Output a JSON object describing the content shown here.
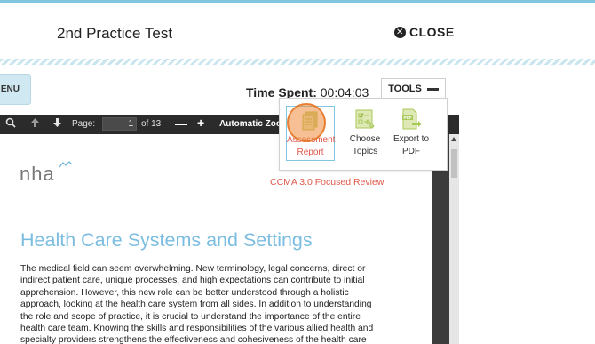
{
  "header": {
    "title": "2nd Practice Test",
    "close_label": "CLOSE"
  },
  "menu": {
    "label": "ENU"
  },
  "timer": {
    "label": "Time Spent:",
    "value": "00:04:03"
  },
  "tools": {
    "tab_label": "TOOLS",
    "items": [
      {
        "label_line1": "Assessment",
        "label_line2": "Report",
        "icon": "assessment-report-icon"
      },
      {
        "label_line1": "Choose",
        "label_line2": "Topics",
        "icon": "choose-topics-icon"
      },
      {
        "label_line1": "Export to",
        "label_line2": "PDF",
        "icon": "export-pdf-icon"
      }
    ]
  },
  "pdf_toolbar": {
    "page_label": "Page:",
    "page_value": "1",
    "page_total": "of 13",
    "zoom_label": "Automatic Zoom"
  },
  "document": {
    "logo_text": "nha",
    "review_tag": "CCMA 3.0 Focused Review",
    "heading": "Health Care Systems and Settings",
    "body": "The medical field can seem overwhelming. New terminology, legal concerns, direct or indirect patient care, unique processes, and high expectations can contribute to initial apprehension. However, this new role can be better understood through a holistic approach, looking at the health care system from all sides. In addition to understanding the role and scope of practice, it is crucial to understand the importance of the entire health care team. Knowing the skills and responsibilities of the various allied health and specialty providers strengthens the effectiveness and cohesiveness of the health care"
  },
  "colors": {
    "accent": "#7fc6de",
    "heading": "#7bbde0",
    "tag": "#e0584a",
    "icon_green": "#a9c95a",
    "highlight": "#f08c3c"
  }
}
